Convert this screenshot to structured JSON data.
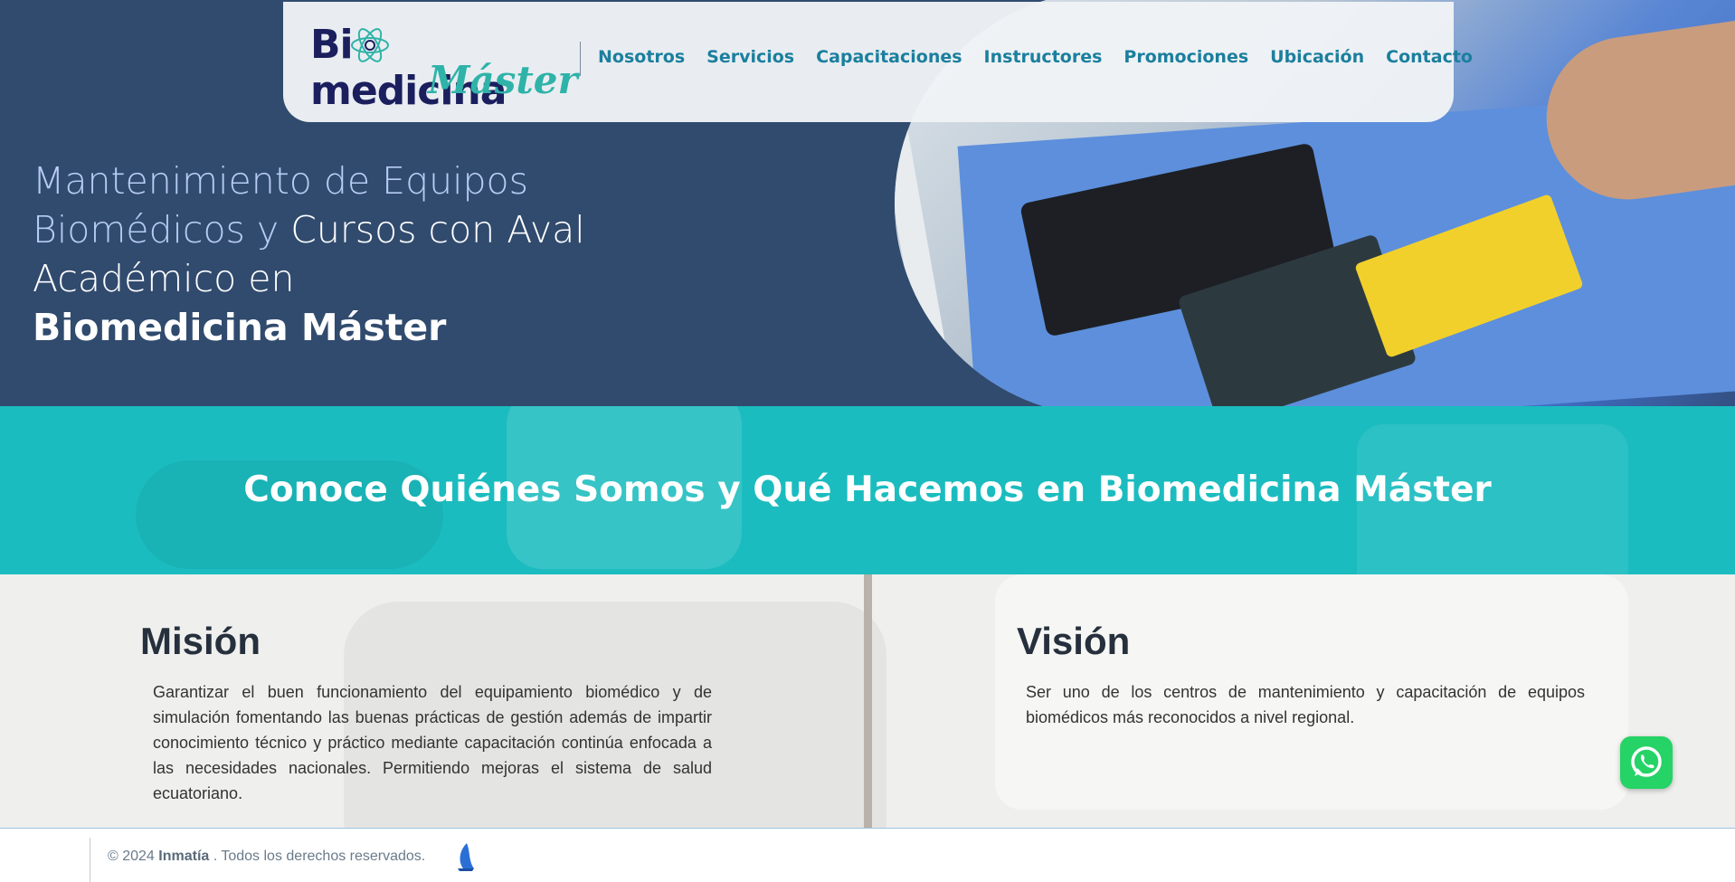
{
  "nav": {
    "logo_main": "Bi medicina",
    "logo_sub": "Máster",
    "links": [
      "Nosotros",
      "Servicios",
      "Capacitaciones",
      "Instructores",
      "Promociones",
      "Ubicación",
      "Contacto"
    ]
  },
  "hero": {
    "title_light": "Mantenimiento de Equipos Biomédicos y",
    "title_normal": "Cursos con Aval Académico en",
    "title_bold": "Biomedicina Máster"
  },
  "about": {
    "title": "Conoce Quiénes Somos y Qué Hacemos en Biomedicina Máster"
  },
  "mission": {
    "heading": "Misión",
    "text": "Garantizar el buen funcionamiento del equipamiento biomédico y de simulación fomentando las buenas prácticas de gestión además de impartir conocimiento técnico y práctico mediante capacitación continúa enfocada a las necesidades nacionales. Permitiendo mejoras el sistema de salud ecuatoriano."
  },
  "vision": {
    "heading": "Visión",
    "text": "Ser uno de los centros de mantenimiento y capacitación de equipos biomédicos más reconocidos a nivel regional."
  },
  "footer": {
    "copyright_prefix": "© 2024",
    "company": "Inmatía",
    "suffix": ". Todos los derechos reservados."
  },
  "icons": {
    "whatsapp": "whatsapp-icon",
    "atom": "atom-icon",
    "footer_logo": "inmatia-logo-icon"
  },
  "colors": {
    "hero_bg": "#314b6e",
    "about_bg": "#1bbcbf",
    "nav_link": "#1b7f9e",
    "logo_dark": "#1b1f5e",
    "logo_teal": "#2fb3a9",
    "whatsapp": "#25d366"
  }
}
